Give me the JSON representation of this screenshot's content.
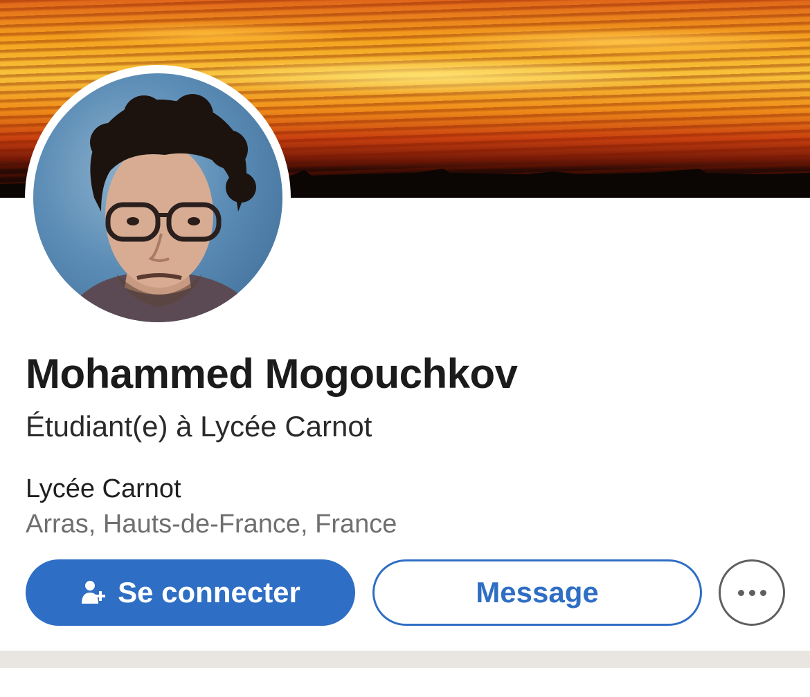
{
  "profile": {
    "name": "Mohammed Mogouchkov",
    "headline": "Étudiant(e) à Lycée Carnot",
    "school": "Lycée Carnot",
    "location": "Arras, Hauts-de-France, France"
  },
  "actions": {
    "connect_label": "Se connecter",
    "connect_icon": "add-person-icon",
    "message_label": "Message",
    "more_icon": "more-options-icon"
  },
  "colors": {
    "accent": "#2e6ec4",
    "text_primary": "#1b1b1b",
    "text_secondary": "#6f6f6f",
    "divider": "#e9e6e1"
  }
}
